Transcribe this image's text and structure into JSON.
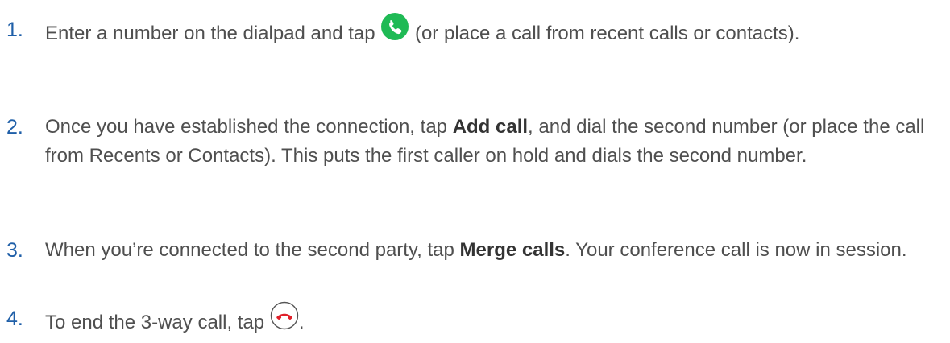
{
  "steps": [
    {
      "number": "1.",
      "text_before": "Enter a number on the dialpad and tap ",
      "icon": "call-button-icon",
      "text_after": " (or place a call from recent calls or contacts)."
    },
    {
      "number": "2.",
      "text_before": "Once you have established the connection, tap ",
      "bold": "Add call",
      "text_after": ", and dial the second number (or place the call from Recents or Contacts). This puts the first caller on hold and dials the second number."
    },
    {
      "number": "3.",
      "text_before": "When you’re connected to the second party, tap ",
      "bold": "Merge calls",
      "text_after": ". Your conference call is now in session."
    },
    {
      "number": "4.",
      "text_before": "To end the 3-way call, tap ",
      "icon": "end-call-icon",
      "text_after": "."
    }
  ],
  "colors": {
    "number": "#1f5fa8",
    "text": "#4f4f4f",
    "call_button": "#1fba55",
    "end_call": "#e0202a"
  }
}
